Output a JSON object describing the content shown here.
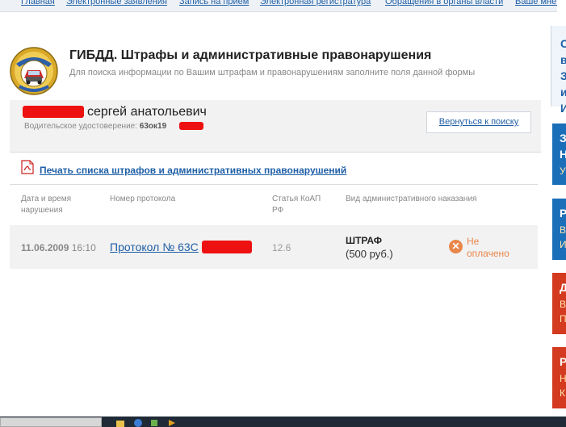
{
  "top_nav": {
    "items": [
      "Главная",
      "Электронные заявления",
      "Запись на прием",
      "Электронная регистратура",
      "Обращения в органы власти",
      "Ваше мнение"
    ]
  },
  "header": {
    "title": "ГИБДД. Штрафы и административные правонарушения",
    "subtitle": "Для поиска информации по Вашим штрафам и правонарушениям заполните поля данной формы"
  },
  "person": {
    "name": "сергей анатольевич",
    "license_label": "Водительское удостоверение:",
    "license_value": "63ок19"
  },
  "back_button": "Вернуться к поиску",
  "print_link": "Печать списка штрафов и административных правонарушений",
  "table": {
    "headers": [
      "Дата и время нарушения",
      "Номер протокола",
      "Статья КоАП РФ",
      "Вид административного наказания"
    ],
    "rows": [
      {
        "date": "11.06.2009",
        "time": "16:10",
        "protocol": "Протокол № 63С",
        "article": "12.6",
        "penalty_type": "ШТРАФ",
        "penalty_amount": "(500 руб.)",
        "status": "Не оплачено"
      }
    ]
  },
  "sidebar": {
    "top_letters": [
      "С",
      "в",
      "З",
      "и",
      "И"
    ],
    "blocks": [
      {
        "letters": [
          "З",
          "Н",
          "У"
        ],
        "color": "#1a6fb8"
      },
      {
        "letters": [
          "Р",
          "В",
          "И"
        ],
        "color": "#1a6fb8"
      },
      {
        "letters": [
          "Д",
          "В",
          "П"
        ],
        "color": "#d33a1f"
      },
      {
        "letters": [
          "Р",
          "Н",
          "К"
        ],
        "color": "#d33a1f"
      }
    ]
  },
  "colors": {
    "link": "#1f5fa6",
    "status_unpaid": "#e8874b",
    "redaction": "#ee1111"
  }
}
